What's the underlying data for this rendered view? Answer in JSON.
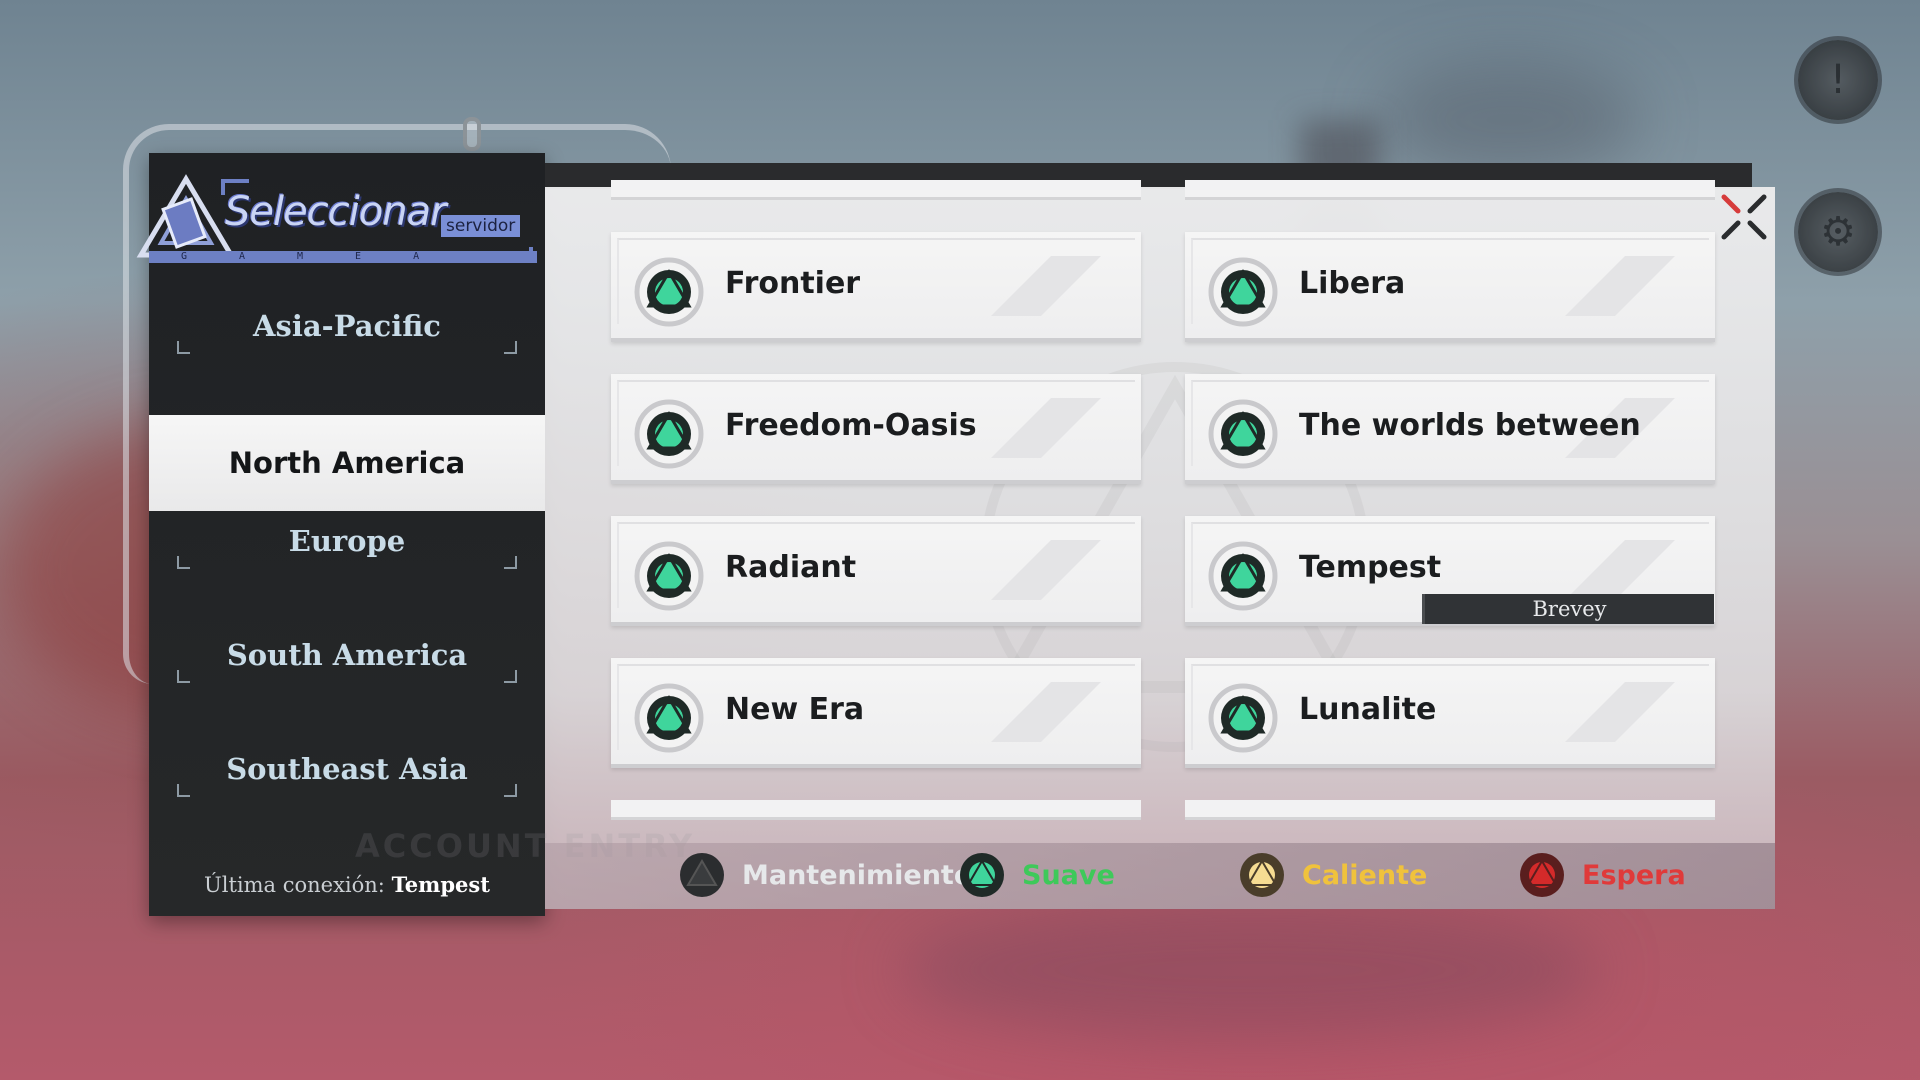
{
  "header": {
    "title": "Seleccionar",
    "subtitle": "servidor",
    "bar_letters": "GAMEA"
  },
  "regions": [
    {
      "label": "Asia-Pacific",
      "active": false
    },
    {
      "label": "North America",
      "active": true
    },
    {
      "label": "Europe",
      "active": false
    },
    {
      "label": "South America",
      "active": false
    },
    {
      "label": "Southeast Asia",
      "active": false
    }
  ],
  "last_connection": {
    "label": "Última conexión:",
    "server": "Tempest"
  },
  "servers": [
    {
      "name": "Frontier",
      "status": "Suave"
    },
    {
      "name": "Libera",
      "status": "Suave"
    },
    {
      "name": "Freedom-Oasis",
      "status": "Suave"
    },
    {
      "name": "The worlds between",
      "status": "Suave"
    },
    {
      "name": "Radiant",
      "status": "Suave"
    },
    {
      "name": "Tempest",
      "status": "Suave",
      "tag": "Brevey"
    },
    {
      "name": "New Era",
      "status": "Suave"
    },
    {
      "name": "Lunalite",
      "status": "Suave"
    }
  ],
  "legend": [
    {
      "label": "Mantenimiento",
      "color": "#e6e8ea",
      "dot": "#3a3c3e"
    },
    {
      "label": "Suave",
      "color": "#3ec95a",
      "dot": "#2fbf8a"
    },
    {
      "label": "Caliente",
      "color": "#f0c23c",
      "dot": "#f2d27a"
    },
    {
      "label": "Espera",
      "color": "#e03a3a",
      "dot": "#d42a2a"
    }
  ],
  "watermarks": [
    "ACCOUNT ENTRY"
  ]
}
